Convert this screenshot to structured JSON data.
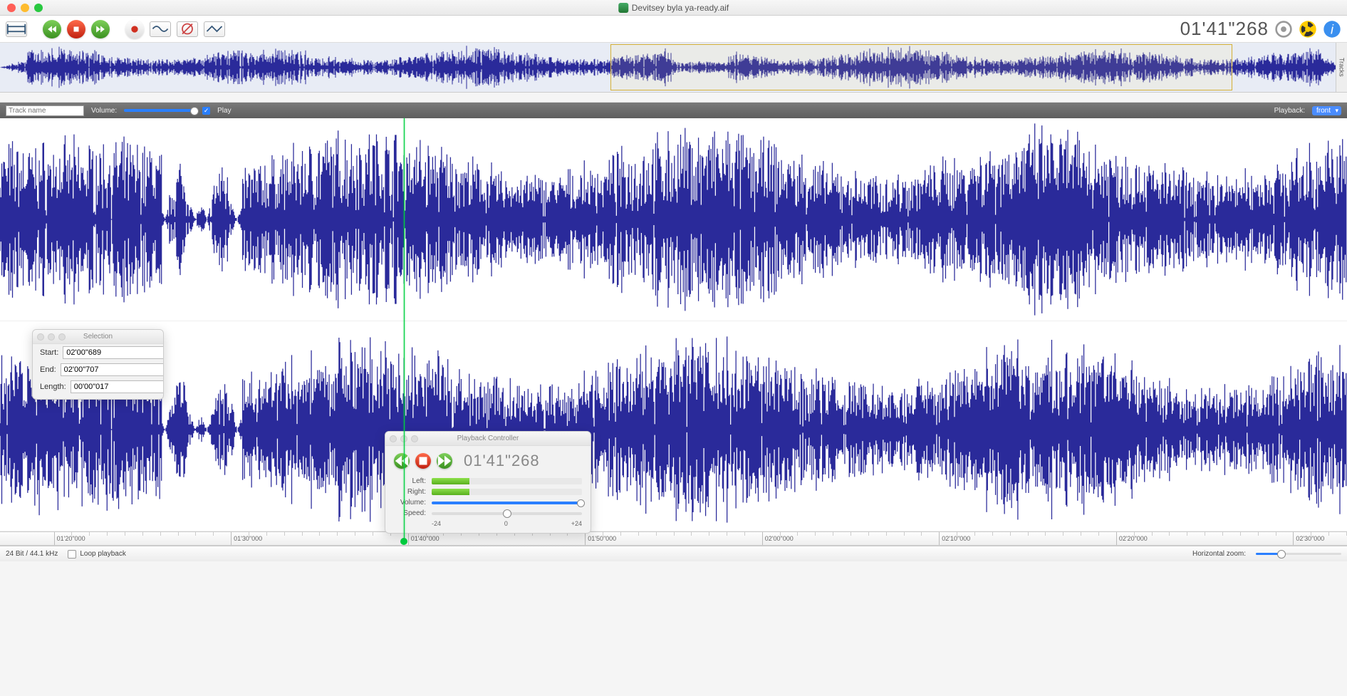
{
  "window": {
    "title": "Devitsey byla ya-ready.aif"
  },
  "toolbar": {
    "time": "01'41\"268"
  },
  "overview": {
    "selection_start_pct": 45.3,
    "selection_end_pct": 91.5
  },
  "trackbar": {
    "trackname_placeholder": "Track name",
    "volume_label": "Volume:",
    "play_label": "Play",
    "playback_label": "Playback:",
    "playback_value": "front"
  },
  "ruler": {
    "ticks": [
      "01'20\"000",
      "01'30\"000",
      "01'40\"000",
      "01'50\"000",
      "02'00\"000",
      "02'10\"000",
      "02'20\"000",
      "02'30\"000"
    ],
    "playhead_pct": 30.0
  },
  "selection_panel": {
    "title": "Selection",
    "start_label": "Start:",
    "start_value": "02'00\"689",
    "end_label": "End:",
    "end_value": "02'00\"707",
    "length_label": "Length:",
    "length_value": "00'00\"017"
  },
  "playback_panel": {
    "title": "Playback Controller",
    "time": "01'41\"268",
    "left_label": "Left:",
    "right_label": "Right:",
    "volume_label": "Volume:",
    "speed_label": "Speed:",
    "speed_min": "-24",
    "speed_mid": "0",
    "speed_max": "+24"
  },
  "statusbar": {
    "format": "24 Bit / 44.1 kHz",
    "loop_label": "Loop playback",
    "hzoom_label": "Horizontal zoom:"
  },
  "tracks_tab": "Tracks"
}
